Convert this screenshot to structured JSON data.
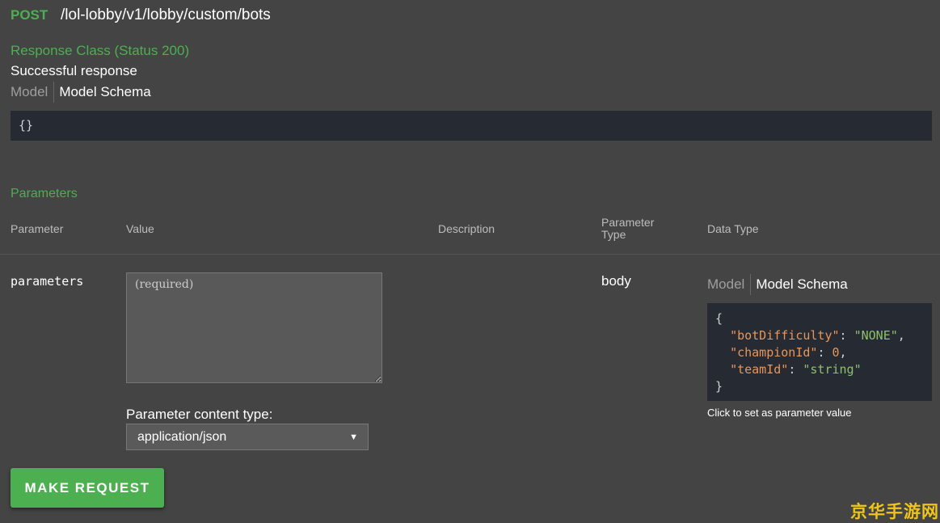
{
  "endpoint": {
    "method": "POST",
    "path": "/lol-lobby/v1/lobby/custom/bots"
  },
  "response": {
    "class_label": "Response Class (Status 200)",
    "description": "Successful response",
    "tabs": {
      "model": "Model",
      "schema": "Model Schema"
    },
    "schema_text": "{}"
  },
  "parameters": {
    "title": "Parameters",
    "headers": {
      "parameter": "Parameter",
      "value": "Value",
      "description": "Description",
      "parameter_type_line1": "Parameter",
      "parameter_type_line2": "Type",
      "data_type": "Data Type"
    },
    "row": {
      "name": "parameters",
      "value": "",
      "placeholder": "(required)",
      "parameter_type": "body",
      "tabs": {
        "model": "Model",
        "schema": "Model Schema"
      },
      "schema": {
        "open": "{",
        "close": "}",
        "fields": [
          {
            "key": "\"botDifficulty\"",
            "value": "\"NONE\"",
            "kind": "string"
          },
          {
            "key": "\"championId\"",
            "value": "0",
            "kind": "number"
          },
          {
            "key": "\"teamId\"",
            "value": "\"string\"",
            "kind": "string"
          }
        ]
      },
      "hint": "Click to set as parameter value"
    },
    "content_type": {
      "label": "Parameter content type:",
      "selected": "application/json"
    }
  },
  "actions": {
    "make_request": "MAKE REQUEST"
  },
  "watermark": "京华手游网",
  "colors": {
    "accent": "#4caf50",
    "background": "#444444",
    "code_background": "#262a33",
    "json_key": "#e8955a",
    "json_string": "#8fc06d",
    "watermark": "#f0c419"
  }
}
